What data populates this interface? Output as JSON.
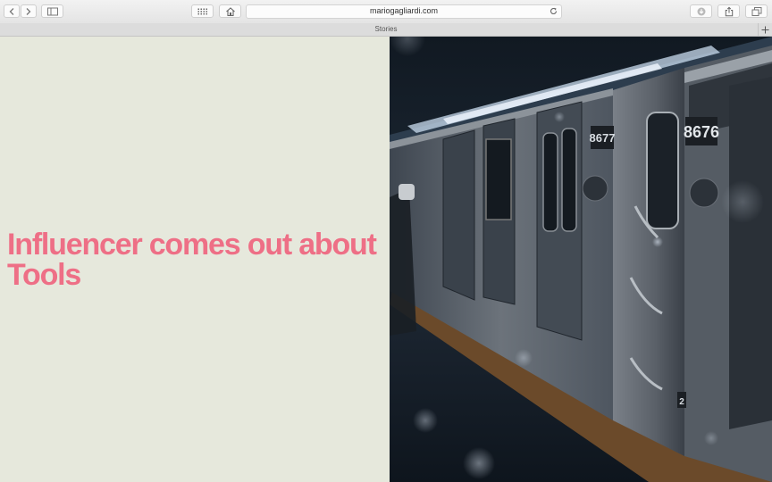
{
  "browser": {
    "url": "mariogagliardi.com",
    "tab_title": "Stories"
  },
  "page": {
    "headline": "Influencer comes out about Tools",
    "hero_image": {
      "car_numbers": [
        "8677",
        "8676"
      ],
      "door_number": "2"
    }
  },
  "colors": {
    "background": "#e6e8dc",
    "headline": "#ee6f86"
  }
}
